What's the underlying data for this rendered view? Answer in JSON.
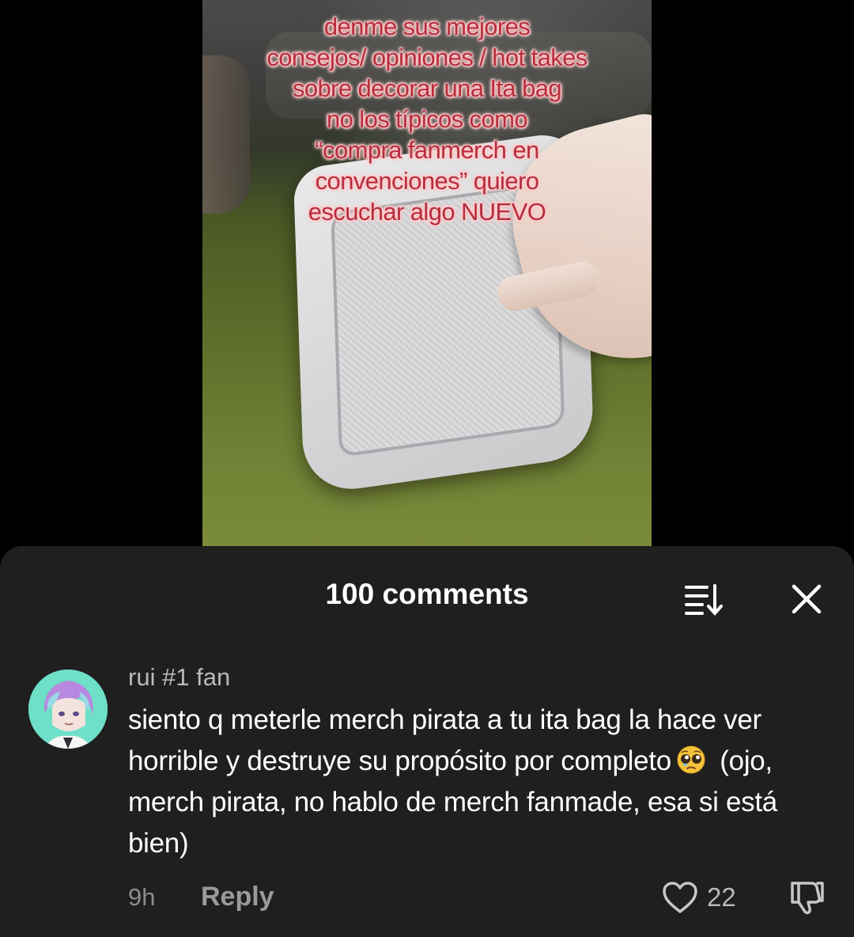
{
  "video": {
    "overlay_lines": [
      "denme sus mejores",
      "consejos/ opiniones / hot takes",
      "sobre decorar una Ita bag",
      "no los típicos como",
      "“compra fanmerch en",
      "convenciones” quiero",
      "escuchar algo NUEVO"
    ]
  },
  "comments_sheet": {
    "title": "100 comments",
    "sort_icon": "sort-icon",
    "close_icon": "close-icon"
  },
  "comment": {
    "username": "rui #1 fan",
    "text_before_emoji": "siento q meterle merch pirata a tu ita bag la hace ver horrible y destruye su propósito por completo",
    "emoji": "pleading-face-emoji",
    "text_after_emoji": " (ojo, merch pirata, no hablo de merch fanmade, esa si está bien)",
    "time": "9h",
    "reply_label": "Reply",
    "like_count": "22",
    "like_icon": "heart-outline-icon",
    "dislike_icon": "thumbs-down-icon"
  },
  "colors": {
    "sheet_bg": "#1f1f1f",
    "overlay_text": "#b62e3e",
    "avatar_bg": "#6ee0c8"
  }
}
